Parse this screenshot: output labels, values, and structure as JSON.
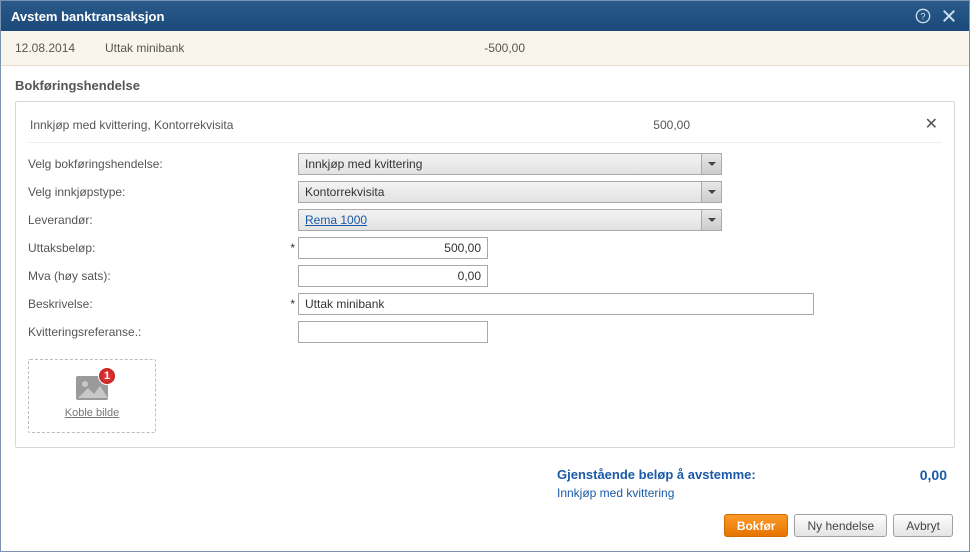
{
  "titlebar": {
    "title": "Avstem banktransaksjon"
  },
  "transaction": {
    "date": "12.08.2014",
    "description": "Uttak minibank",
    "amount": "-500,00"
  },
  "section": {
    "heading": "Bokføringshendelse"
  },
  "summary": {
    "text": "Innkjøp med kvittering, Kontorrekvisita",
    "amount": "500,00"
  },
  "form": {
    "event_label": "Velg bokføringshendelse:",
    "event_value": "Innkjøp med kvittering",
    "purchase_type_label": "Velg innkjøpstype:",
    "purchase_type_value": "Kontorrekvisita",
    "supplier_label": "Leverandør:",
    "supplier_value": "Rema 1000",
    "amount_label": "Uttaksbeløp:",
    "amount_value": "500,00",
    "vat_label": "Mva (høy sats):",
    "vat_value": "0,00",
    "description_label": "Beskrivelse:",
    "description_value": "Uttak minibank",
    "reference_label": "Kvitteringsreferanse.:",
    "reference_value": "",
    "required_mark": "*"
  },
  "attach": {
    "label": "Koble bilde",
    "badge": "1"
  },
  "totals": {
    "title": "Gjenstående beløp å avstemme:",
    "subtitle": "Innkjøp med kvittering",
    "amount": "0,00"
  },
  "buttons": {
    "primary": "Bokfør",
    "secondary": "Ny hendelse",
    "cancel": "Avbryt"
  }
}
